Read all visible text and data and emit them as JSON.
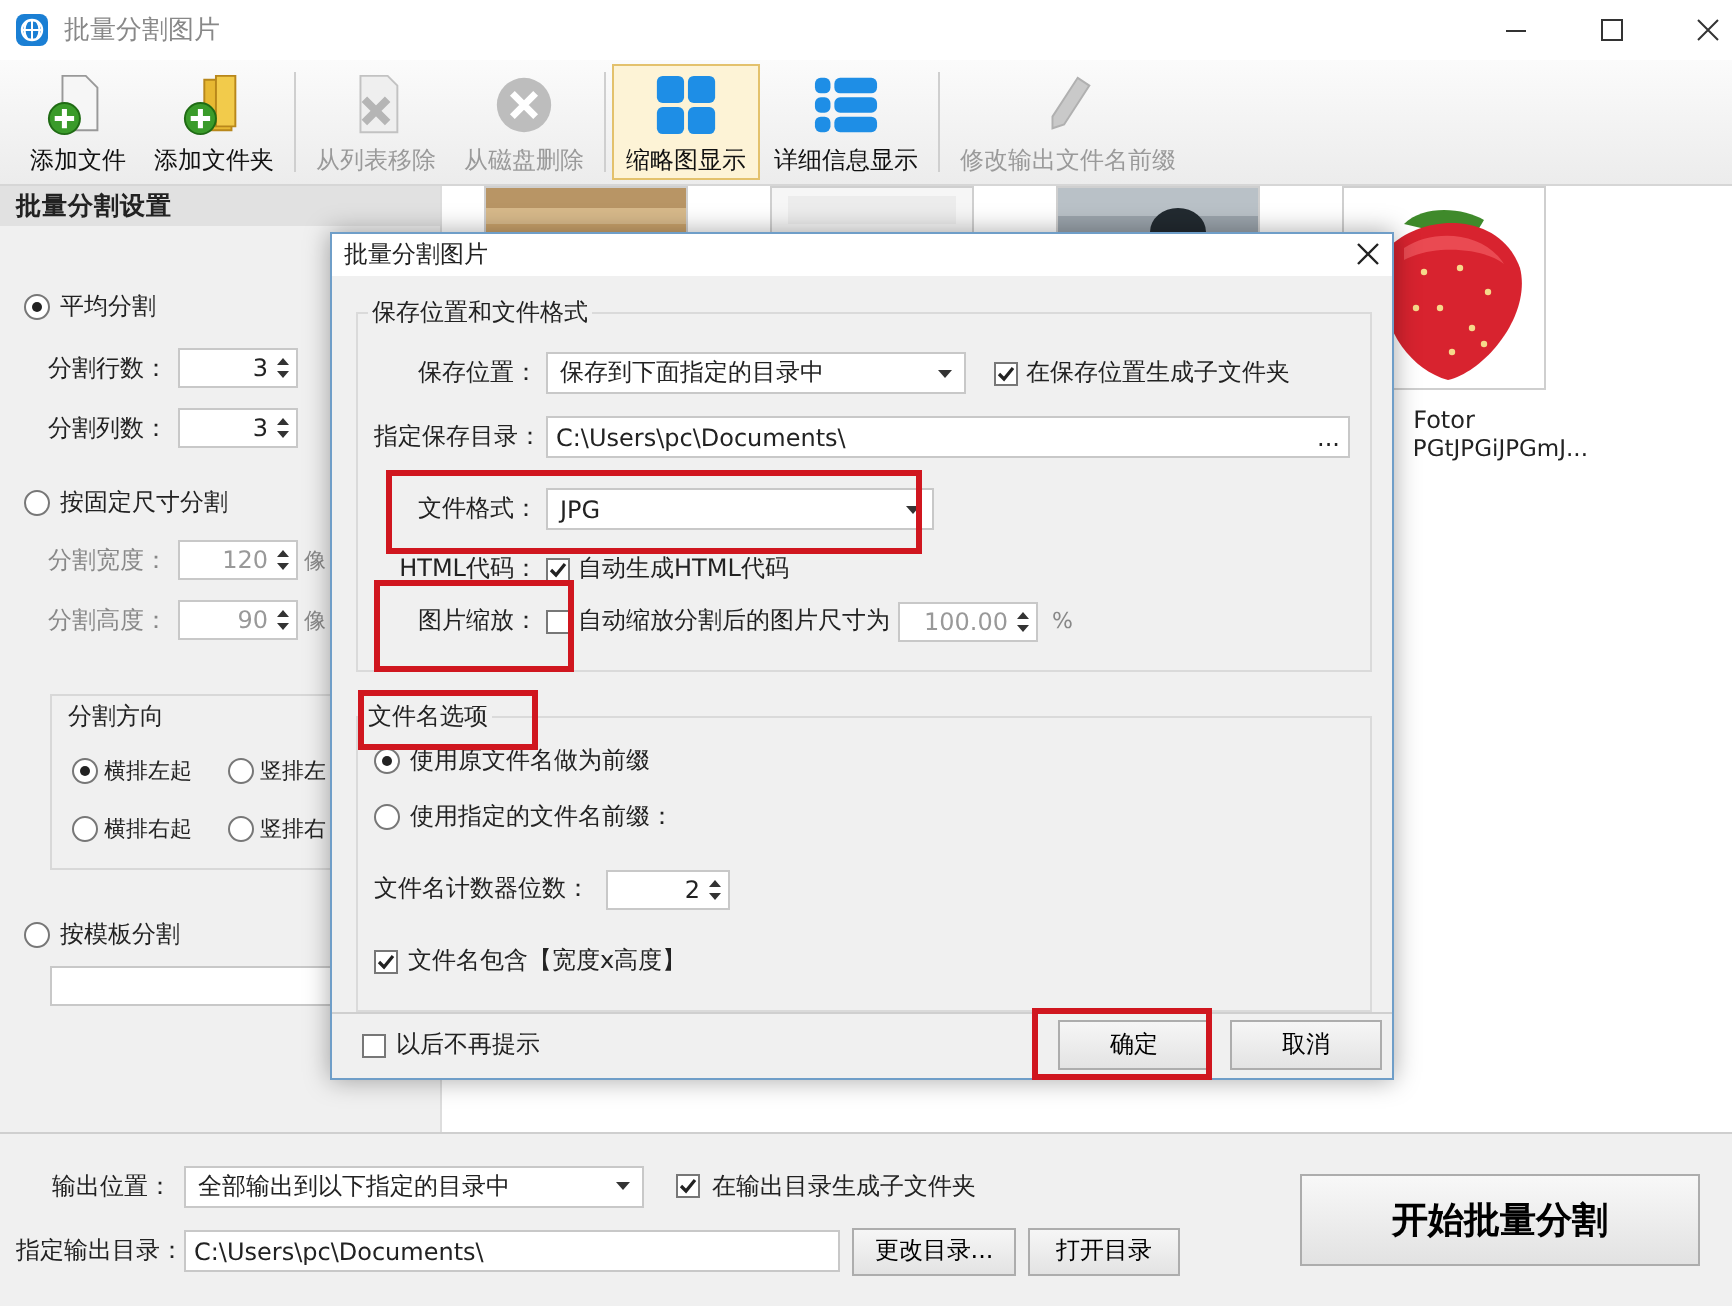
{
  "window": {
    "title": "批量分割图片"
  },
  "toolbar": [
    {
      "label": "添加文件",
      "disabled": false,
      "selected": false
    },
    {
      "label": "添加文件夹",
      "disabled": false,
      "selected": false
    },
    {
      "label": "从列表移除",
      "disabled": true,
      "selected": false
    },
    {
      "label": "从磁盘删除",
      "disabled": true,
      "selected": false
    },
    {
      "label": "缩略图显示",
      "disabled": false,
      "selected": true
    },
    {
      "label": "详细信息显示",
      "disabled": false,
      "selected": false
    },
    {
      "label": "修改输出文件名前缀",
      "disabled": true,
      "selected": false
    }
  ],
  "split_settings": {
    "title": "批量分割设置",
    "even_split": {
      "label": "平均分割",
      "selected": true
    },
    "rows_field": {
      "label": "分割行数：",
      "value": "3",
      "disabled": false
    },
    "cols_field": {
      "label": "分割列数：",
      "value": "3",
      "disabled": false
    },
    "fixed_split": {
      "label": "按固定尺寸分割",
      "selected": false
    },
    "width_field": {
      "label": "分割宽度：",
      "value": "120",
      "unit": "像",
      "disabled": true
    },
    "height_field": {
      "label": "分割高度：",
      "value": "90",
      "unit": "像",
      "disabled": true
    },
    "direction": {
      "title": "分割方向",
      "options": [
        {
          "label": "横排左起",
          "selected": true
        },
        {
          "label": "竖排左",
          "selected": false
        },
        {
          "label": "横排右起",
          "selected": false
        },
        {
          "label": "竖排右",
          "selected": false
        }
      ]
    },
    "template_split": {
      "label": "按模板分割",
      "selected": false
    }
  },
  "thumbnails": [
    {
      "kind": "picture"
    },
    {
      "kind": "picture"
    },
    {
      "kind": "picture"
    },
    {
      "kind": "picture",
      "caption": [
        "Fotor",
        "PGtJPGiJPGmJ..."
      ]
    }
  ],
  "dialog": {
    "title": "批量分割图片",
    "save_group": {
      "title": "保存位置和文件格式",
      "location_label": "保存位置：",
      "location_value": "保存到下面指定的目录中",
      "subfolder": {
        "label": "在保存位置生成子文件夹",
        "checked": true
      },
      "dir_label": "指定保存目录：",
      "dir_value": "C:\\Users\\pc\\Documents\\",
      "browse": "...",
      "format_label": "文件格式：",
      "format_value": "JPG",
      "format_highlighted": true,
      "html_label": "HTML代码：",
      "html_check": {
        "label": "自动生成HTML代码",
        "checked": true
      },
      "scale_label": "图片缩放：",
      "scale_highlighted": true,
      "scale_check": {
        "label": "自动缩放分割后的图片尺寸为",
        "checked": false
      },
      "scale_value": "100.00",
      "scale_unit": "%"
    },
    "name_group": {
      "title": "文件名选项",
      "highlighted": true,
      "options": [
        {
          "label": "使用原文件名做为前缀",
          "selected": true
        },
        {
          "label": "使用指定的文件名前缀：",
          "selected": false
        }
      ],
      "counter_label": "文件名计数器位数：",
      "counter_value": "2",
      "size_check": {
        "label": "文件名包含【宽度x高度】",
        "checked": true
      }
    },
    "dont_show": {
      "label": "以后不再提示",
      "checked": false
    },
    "buttons": [
      {
        "label": "确定",
        "highlighted": true
      },
      {
        "label": "取消",
        "highlighted": false
      }
    ]
  },
  "output": {
    "location_label": "输出位置：",
    "location_value": "全部输出到以下指定的目录中",
    "subfolder": {
      "label": "在输出目录生成子文件夹",
      "checked": true
    },
    "dir_label": "指定输出目录：",
    "dir_value": "C:\\Users\\pc\\Documents\\",
    "buttons": [
      "更改目录...",
      "打开目录"
    ],
    "start": "开始批量分割"
  }
}
